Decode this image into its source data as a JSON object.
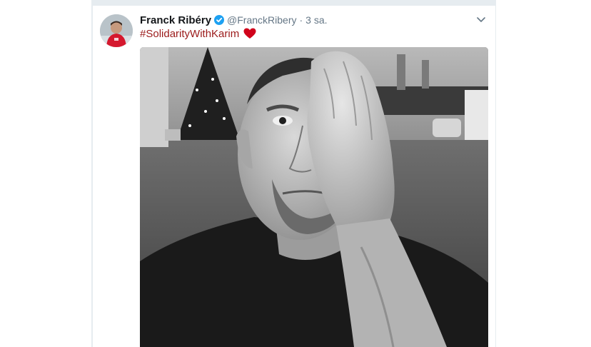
{
  "tweet": {
    "author_name": "Franck Ribéry",
    "author_handle": "@FranckRibery",
    "separator": "·",
    "timestamp": "3 sa.",
    "hashtag": "#SolidarityWithKarim"
  },
  "icons": {
    "verified": "verified-badge-icon",
    "caret": "chevron-down-icon",
    "emoji": "red-heart-icon"
  },
  "colors": {
    "hashtag": "#9b1a1a",
    "verified": "#1da1f2",
    "heart": "#d0021b",
    "feed_background": "#e6ecf0"
  }
}
